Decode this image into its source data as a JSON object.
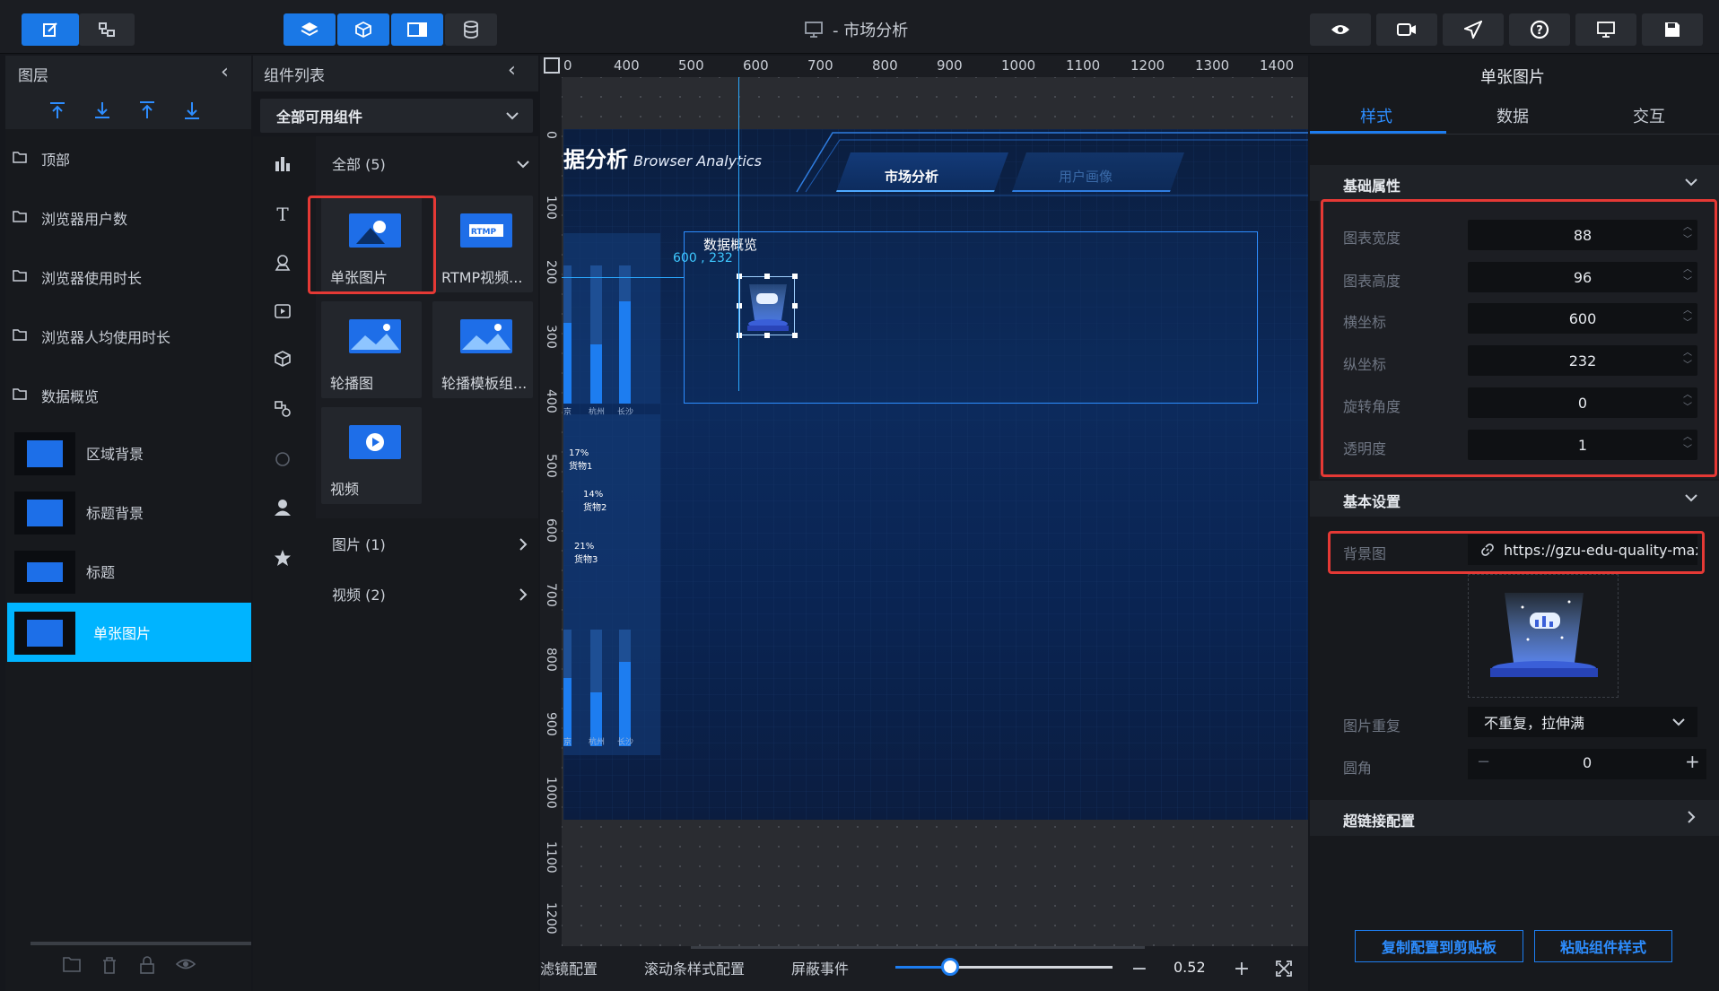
{
  "app": {
    "title": "- 市场分析"
  },
  "left_panel": {
    "title": "图层",
    "layers": [
      {
        "label": "顶部",
        "type": "folder"
      },
      {
        "label": "浏览器用户数",
        "type": "folder"
      },
      {
        "label": "浏览器使用时长",
        "type": "folder"
      },
      {
        "label": "浏览器人均使用时长",
        "type": "folder"
      },
      {
        "label": "数据概览",
        "type": "folder"
      },
      {
        "label": "区域背景",
        "type": "item"
      },
      {
        "label": "标题背景",
        "type": "item"
      },
      {
        "label": "标题",
        "type": "item"
      },
      {
        "label": "单张图片",
        "type": "item",
        "selected": true
      }
    ]
  },
  "component_panel": {
    "title": "组件列表",
    "filter": "全部可用组件",
    "categories": {
      "all": "全部 (5)",
      "image": "图片 (1)",
      "video": "视频 (2)"
    },
    "components": [
      "单张图片",
      "RTMP视频...",
      "轮播图",
      "轮播模板组...",
      "视频"
    ]
  },
  "canvas": {
    "ruler_x": [
      "0",
      "400",
      "500",
      "600",
      "700",
      "800",
      "900",
      "1000",
      "1100",
      "1200",
      "1300",
      "1400"
    ],
    "ruler_y": [
      "0",
      "100",
      "200",
      "300",
      "400",
      "500",
      "600",
      "700",
      "800",
      "900",
      "1000",
      "1100",
      "1200"
    ],
    "screen_title": "据分析",
    "screen_subtitle": "Browser Analytics",
    "nav_tabs": [
      "市场分析",
      "用户画像"
    ],
    "box_title": "数据概览",
    "coord_readout": "600 , 232",
    "bar_labels": [
      "京",
      "杭州",
      "长沙"
    ],
    "pie_labels": [
      {
        "pct": "17%",
        "name": "货物1"
      },
      {
        "pct": "14%",
        "name": "货物2"
      },
      {
        "pct": "21%",
        "name": "货物3"
      }
    ]
  },
  "bottom_bar": {
    "items": [
      "滤镜配置",
      "滚动条样式配置",
      "屏蔽事件"
    ],
    "zoom_value": "0.52",
    "zoom_fraction": 0.25
  },
  "right_panel": {
    "title": "单张图片",
    "tabs": [
      "样式",
      "数据",
      "交互"
    ],
    "active_tab": "样式",
    "basic_props_title": "基础属性",
    "props": [
      {
        "label": "图表宽度",
        "value": "88"
      },
      {
        "label": "图表高度",
        "value": "96"
      },
      {
        "label": "横坐标",
        "value": "600"
      },
      {
        "label": "纵坐标",
        "value": "232"
      },
      {
        "label": "旋转角度",
        "value": "0"
      },
      {
        "label": "透明度",
        "value": "1"
      }
    ],
    "basic_settings_title": "基本设置",
    "bg_label": "背景图",
    "bg_url": "https://gzu-edu-quality-max",
    "repeat_label": "图片重复",
    "repeat_value": "不重复，拉伸满",
    "radius_label": "圆角",
    "radius_value": "0",
    "hyperlink_title": "超链接配置",
    "copy_button": "复制配置到剪贴板",
    "paste_button": "粘贴组件样式"
  },
  "colors": {
    "accent": "#1a78e6",
    "selected": "#00b4ff",
    "highlight": "#e53935"
  }
}
